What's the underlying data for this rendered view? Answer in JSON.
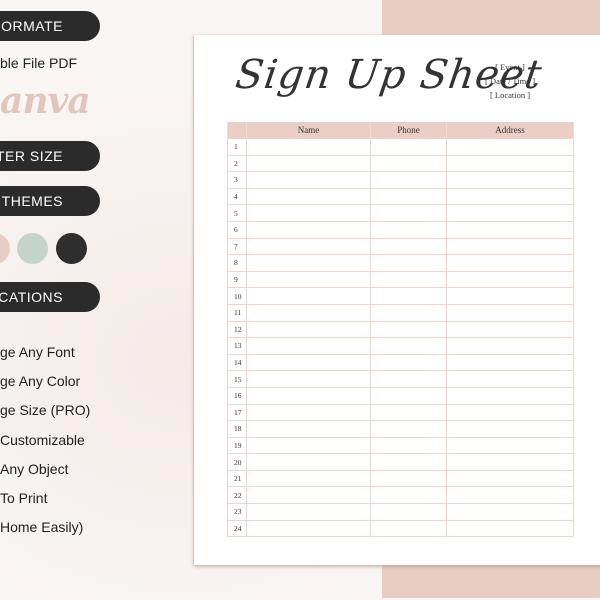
{
  "sidebar": {
    "pills": [
      {
        "label": "ORMATE"
      },
      {
        "label": "TTER SIZE"
      },
      {
        "label": "R THEMES"
      },
      {
        "label": "ICATIONS"
      }
    ],
    "file_type_text": "ble File PDF",
    "brand_logo": "anva",
    "color_swatches": [
      {
        "name": "blush",
        "color": "#e8cdc3"
      },
      {
        "name": "sage",
        "color": "#c4d3cb"
      },
      {
        "name": "charcoal",
        "color": "#2e2e2e"
      }
    ],
    "features": [
      "ge Any Font",
      "ge Any Color",
      "ge Size (PRO)",
      "Customizable",
      "Any Object",
      "To Print",
      "Home Easily)"
    ]
  },
  "sheet": {
    "title": "Sign Up Sheet",
    "meta": [
      "[ Event ]",
      "[ Date / Time ]",
      "[ Location ]"
    ],
    "columns": [
      "",
      "Name",
      "Phone",
      "Address"
    ],
    "row_numbers": [
      "1",
      "2",
      "3",
      "4",
      "5",
      "6",
      "7",
      "8",
      "9",
      "10",
      "11",
      "12",
      "13",
      "14",
      "15",
      "16",
      "17",
      "18",
      "19",
      "20",
      "21",
      "22",
      "23",
      "24"
    ]
  },
  "colors": {
    "accent_pink": "#e8cdc3",
    "header_pink": "#ebcfc6",
    "pill_dark": "#2b2b2b"
  }
}
